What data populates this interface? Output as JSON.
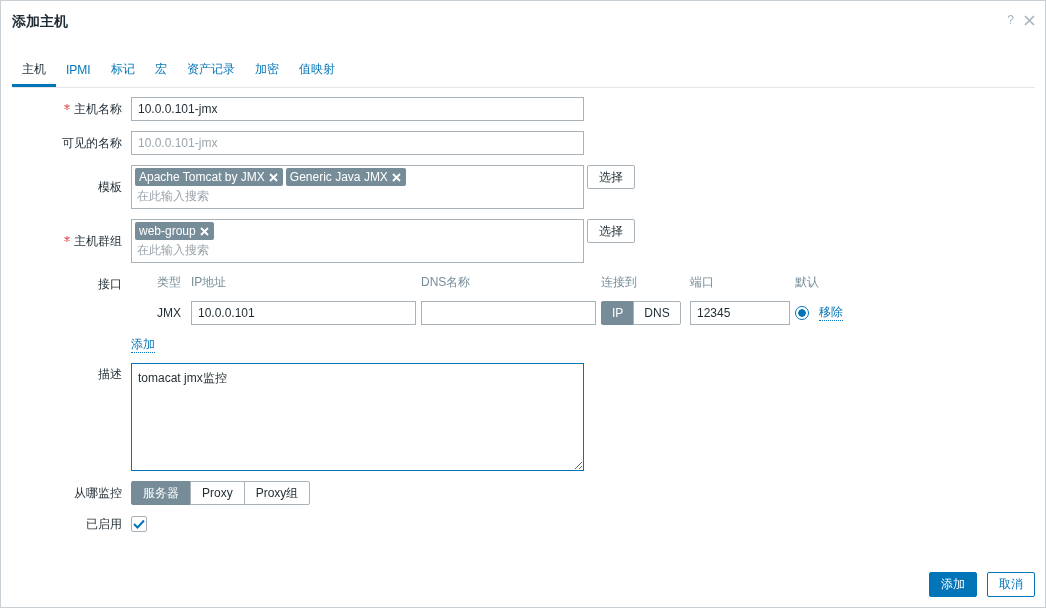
{
  "dialog": {
    "title": "添加主机",
    "help": "?"
  },
  "tabs": [
    {
      "label": "主机",
      "selected": true
    },
    {
      "label": "IPMI",
      "selected": false
    },
    {
      "label": "标记",
      "selected": false
    },
    {
      "label": "宏",
      "selected": false
    },
    {
      "label": "资产记录",
      "selected": false
    },
    {
      "label": "加密",
      "selected": false
    },
    {
      "label": "值映射",
      "selected": false
    }
  ],
  "host_name": {
    "label": "主机名称",
    "required": true,
    "value": "10.0.0.101-jmx"
  },
  "visible_name": {
    "label": "可见的名称",
    "required": false,
    "placeholder": "10.0.0.101-jmx"
  },
  "templates": {
    "label": "模板",
    "required": false,
    "tags": [
      "Apache Tomcat by JMX",
      "Generic Java JMX"
    ],
    "placeholder": "在此输入搜索",
    "button": "选择"
  },
  "host_groups": {
    "label": "主机群组",
    "required": true,
    "tags": [
      "web-group"
    ],
    "placeholder": "在此输入搜索",
    "button": "选择"
  },
  "interfaces": {
    "label": "接口",
    "columns": [
      "类型",
      "IP地址",
      "DNS名称",
      "连接到",
      "端口",
      "默认"
    ],
    "rows": [
      {
        "type": "JMX",
        "ip": "10.0.0.101",
        "connect": [
          {
            "label": "IP",
            "selected": true
          },
          {
            "label": "DNS",
            "selected": false
          }
        ],
        "port": "12345",
        "default": true,
        "remove": "移除"
      }
    ],
    "add_link": "添加"
  },
  "description": {
    "label": "描述",
    "value": "tomacat jmx监控"
  },
  "monitored_by": {
    "label": "从哪监控",
    "options": [
      {
        "label": "服务器",
        "selected": true
      },
      {
        "label": "Proxy",
        "selected": false
      },
      {
        "label": "Proxy组",
        "selected": false
      }
    ]
  },
  "enabled": {
    "label": "已启用",
    "checked": true
  },
  "buttons": [
    {
      "label": "添加",
      "kind": "primary"
    },
    {
      "label": "取消",
      "kind": "secondary"
    }
  ]
}
